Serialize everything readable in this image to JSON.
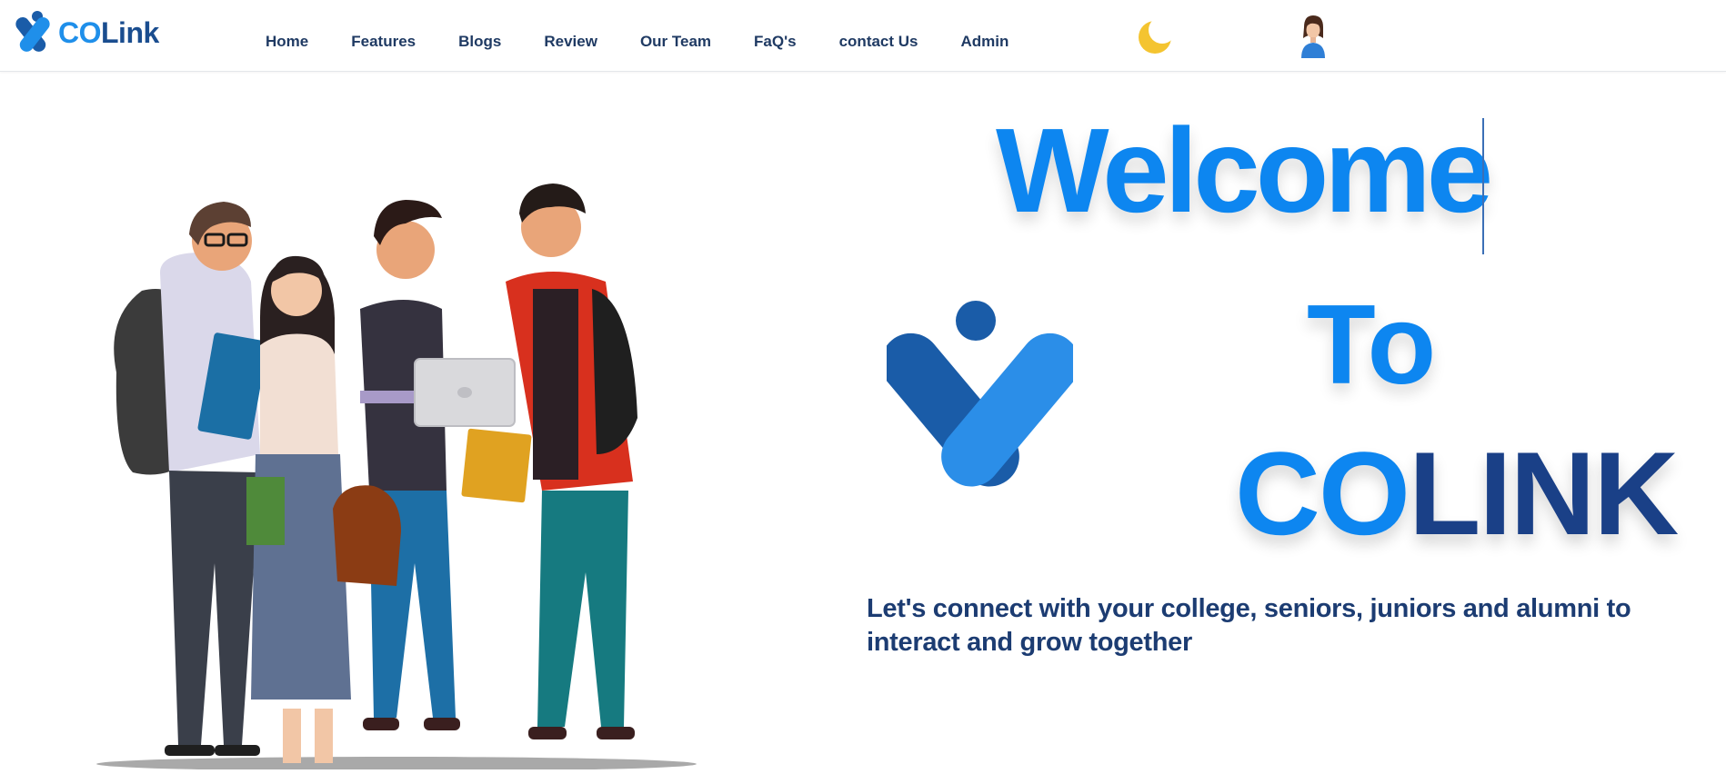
{
  "brand": {
    "name_part1": "CO",
    "name_part2": "Link",
    "logo_icon": "colink-x-logo"
  },
  "nav": {
    "links": [
      {
        "label": "Home"
      },
      {
        "label": "Features"
      },
      {
        "label": "Blogs"
      },
      {
        "label": "Review"
      },
      {
        "label": "Our Team"
      },
      {
        "label": "FaQ's"
      },
      {
        "label": "contact Us"
      },
      {
        "label": "Admin"
      }
    ],
    "theme_toggle_icon": "moon-icon",
    "profile_icon": "user-avatar-icon"
  },
  "hero": {
    "line1": "Welcome",
    "line2": "To",
    "line3_part1": "CO",
    "line3_part2": "LINK",
    "tagline": "Let's connect with your college, seniors, juniors and alumni to interact and grow together",
    "illustration": "group-of-students-illustration"
  },
  "colors": {
    "primary_blue": "#0d86f0",
    "dark_blue": "#1a4087",
    "nav_text": "#1f3a63",
    "moon": "#f4c430"
  }
}
